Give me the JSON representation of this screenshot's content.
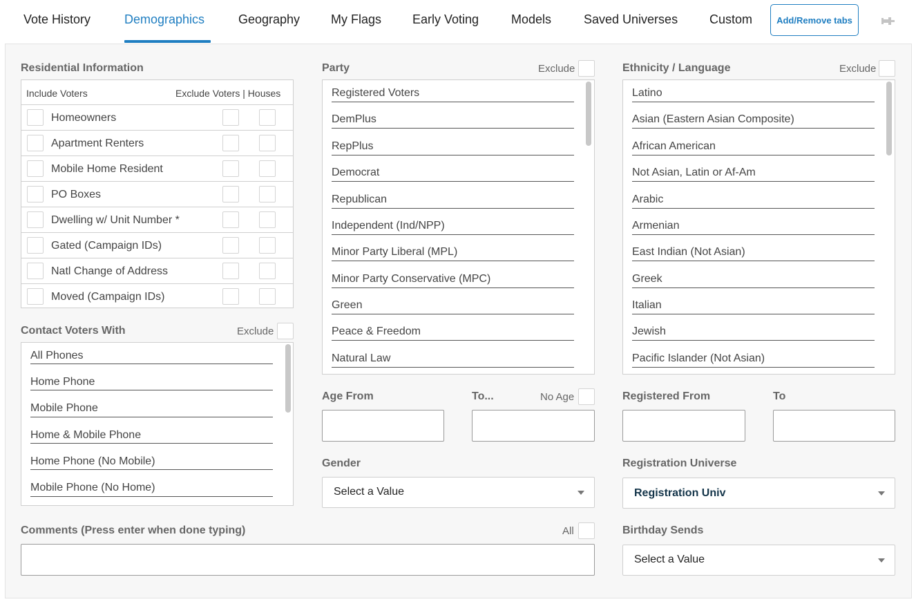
{
  "tabs": {
    "items": [
      "Vote History",
      "Demographics",
      "Geography",
      "My Flags",
      "Early Voting",
      "Models",
      "Saved Universes",
      "Custom"
    ],
    "active": "Demographics",
    "add_remove_label": "Add/Remove tabs",
    "pin_icon": "pin-icon"
  },
  "residential": {
    "title": "Residential Information",
    "header_include": "Include Voters",
    "header_exclude": "Exclude Voters | Houses",
    "rows": [
      "Homeowners",
      "Apartment Renters",
      "Mobile Home Resident",
      "PO Boxes",
      "Dwelling w/ Unit Number *",
      "Gated (Campaign IDs)",
      "Natl Change of Address",
      "Moved (Campaign IDs)"
    ]
  },
  "contact": {
    "title": "Contact Voters With",
    "exclude_label": "Exclude",
    "items": [
      "All Phones",
      "Home Phone",
      "Mobile Phone",
      "Home & Mobile Phone",
      "Home Phone (No Mobile)",
      "Mobile Phone (No Home)"
    ]
  },
  "party": {
    "title": "Party",
    "exclude_label": "Exclude",
    "items": [
      "Registered Voters",
      "DemPlus",
      "RepPlus",
      "Democrat",
      "Republican",
      "Independent (Ind/NPP)",
      "Minor Party Liberal (MPL)",
      "Minor Party Conservative (MPC)",
      "Green",
      "Peace & Freedom",
      "Natural Law"
    ]
  },
  "ethnicity": {
    "title": "Ethnicity / Language",
    "exclude_label": "Exclude",
    "items": [
      "Latino",
      "Asian (Eastern Asian Composite)",
      "African American",
      "Not Asian, Latin or Af-Am",
      "Arabic",
      "Armenian",
      "East Indian (Not Asian)",
      "Greek",
      "Italian",
      "Jewish",
      "Pacific Islander (Not Asian)"
    ]
  },
  "age": {
    "from_label": "Age From",
    "to_label": "To...",
    "no_age_label": "No Age",
    "from_value": "",
    "to_value": ""
  },
  "registered": {
    "from_label": "Registered From",
    "to_label": "To",
    "from_value": "",
    "to_value": ""
  },
  "gender": {
    "label": "Gender",
    "value": "Select a Value"
  },
  "registration_universe": {
    "label": "Registration Universe",
    "value": "Registration Univ"
  },
  "comments": {
    "label": "Comments (Press enter when done typing)",
    "all_label": "All",
    "value": ""
  },
  "birthday": {
    "label": "Birthday Sends",
    "value": "Select a Value"
  },
  "colors": {
    "accent": "#1f7ec1",
    "panel_bg": "#f7f7f7"
  }
}
